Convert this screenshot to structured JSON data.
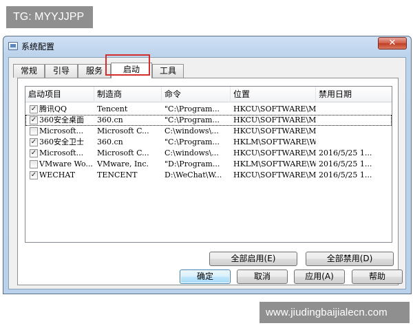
{
  "watermarks": {
    "top": "TG: MYYJJPP",
    "bottom": "www.jiudingbaijialecn.com"
  },
  "window": {
    "title": "系统配置",
    "close_glyph": "✕",
    "icon": "settings-window-icon"
  },
  "tabs": [
    {
      "label": "常规"
    },
    {
      "label": "引导"
    },
    {
      "label": "服务"
    },
    {
      "label": "启动",
      "active": true
    },
    {
      "label": "工具"
    }
  ],
  "startup_list": {
    "columns": [
      "启动项目",
      "制造商",
      "命令",
      "位置",
      "禁用日期"
    ],
    "rows": [
      {
        "checked": true,
        "name": "腾讯QQ",
        "vendor": "Tencent",
        "command": "\"C:\\Program...",
        "location": "HKCU\\SOFTWARE\\M...",
        "date": ""
      },
      {
        "checked": true,
        "name": "360安全桌面",
        "vendor": "360.cn",
        "command": "\"C:\\Program...",
        "location": "HKCU\\SOFTWARE\\M...",
        "date": "",
        "focused": true
      },
      {
        "checked": false,
        "name": "Microsoft...",
        "vendor": "Microsoft C...",
        "command": "C:\\windows\\...",
        "location": "HKCU\\SOFTWARE\\M...",
        "date": ""
      },
      {
        "checked": true,
        "name": "360安全卫士",
        "vendor": "360.cn",
        "command": "\"C:\\Program...",
        "location": "HKLM\\SOFTWARE\\W...",
        "date": ""
      },
      {
        "checked": true,
        "name": "Microsoft...",
        "vendor": "Microsoft C...",
        "command": "C:\\windows\\...",
        "location": "HKCU\\SOFTWARE\\M...",
        "date": "2016/5/25 1..."
      },
      {
        "checked": false,
        "name": "VMware Wo...",
        "vendor": "VMware, Inc.",
        "command": "\"D:\\Program...",
        "location": "HKLM\\SOFTWARE\\W...",
        "date": "2016/5/25 1..."
      },
      {
        "checked": true,
        "name": "WECHAT",
        "vendor": "TENCENT",
        "command": "D:\\WeChat\\W...",
        "location": "HKCU\\SOFTWARE\\M...",
        "date": "2016/5/25 1..."
      }
    ]
  },
  "panel_buttons": {
    "enable_all": "全部启用(E)",
    "disable_all": "全部禁用(D)"
  },
  "dialog_buttons": {
    "ok": "确定",
    "cancel": "取消",
    "apply": "应用(A)",
    "help": "帮助"
  },
  "colors": {
    "highlight_box": "#d42b2b",
    "watermark_bg": "#8f8f8f",
    "window_frame": "#bcd3ec"
  }
}
